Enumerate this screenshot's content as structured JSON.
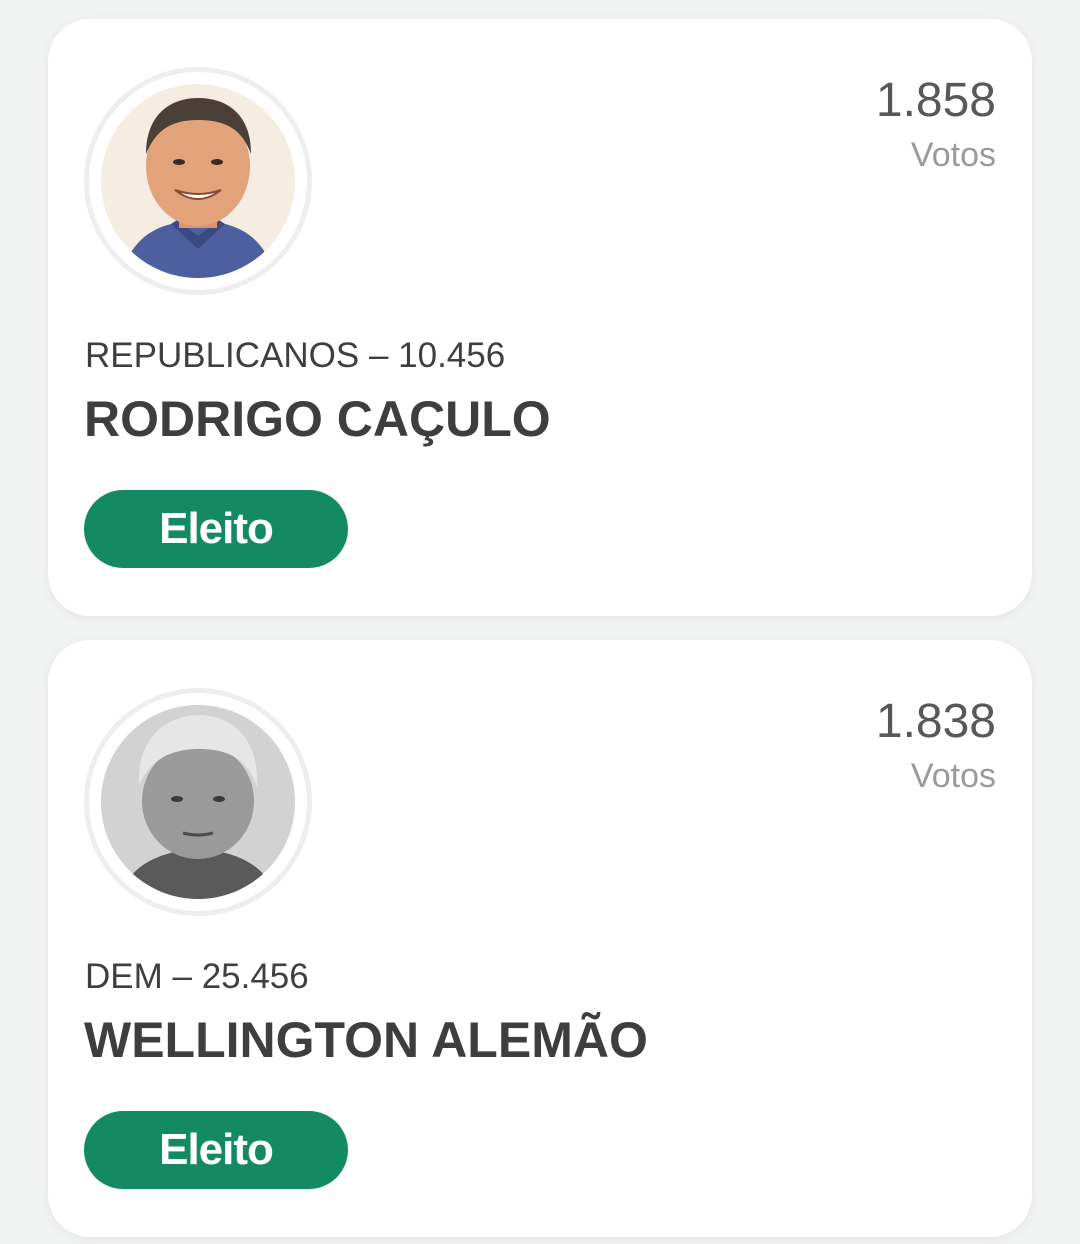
{
  "candidates": [
    {
      "votes": "1.858",
      "votes_label": "Votos",
      "party_number": "REPUBLICANOS – 10.456",
      "name": "RODRIGO CAÇULO",
      "status": "Eleito",
      "status_color": "#148a62",
      "avatar_icon": "candidate-photo-color"
    },
    {
      "votes": "1.838",
      "votes_label": "Votos",
      "party_number": "DEM – 25.456",
      "name": "WELLINGTON ALEMÃO",
      "status": "Eleito",
      "status_color": "#148a62",
      "avatar_icon": "candidate-photo-grayscale"
    }
  ]
}
